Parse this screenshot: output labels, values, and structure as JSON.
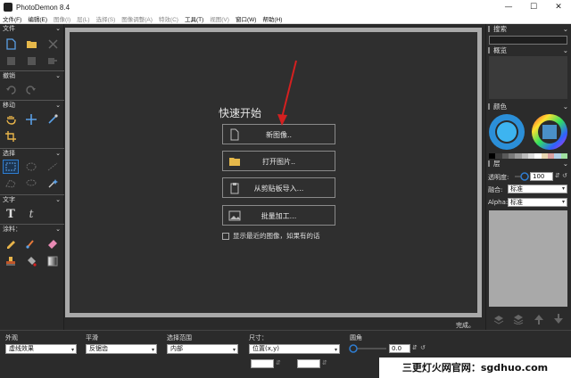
{
  "window": {
    "title": "PhotoDemon 8.4",
    "minimize": "—",
    "maximize": "☐",
    "close": "✕"
  },
  "menu": [
    {
      "label": "文件(F)",
      "enabled": true
    },
    {
      "label": "编辑(E)",
      "enabled": true
    },
    {
      "label": "图像(I)",
      "enabled": false
    },
    {
      "label": "层(L)",
      "enabled": false
    },
    {
      "label": "选择(S)",
      "enabled": false
    },
    {
      "label": "图像调整(A)",
      "enabled": false
    },
    {
      "label": "特效(C)",
      "enabled": false
    },
    {
      "label": "工具(T)",
      "enabled": true
    },
    {
      "label": "视图(V)",
      "enabled": false
    },
    {
      "label": "窗口(W)",
      "enabled": true
    },
    {
      "label": "帮助(H)",
      "enabled": true
    }
  ],
  "toolbox": {
    "sections": {
      "file": "文件",
      "undo": "撤销",
      "move": "移动",
      "select": "选择",
      "text": "文字",
      "paint": "涂料："
    }
  },
  "quick_start": {
    "title": "快速开始",
    "buttons": [
      "新图像..",
      "打开图片..",
      "从剪贴板导入...",
      "批量加工..."
    ],
    "recent_checkbox": "显示最近的图像，如果有的话"
  },
  "status": {
    "text": "完成。"
  },
  "right_panel": {
    "search": "搜索",
    "overview": "概览",
    "color": "颜色",
    "layers": "层",
    "opacity_label": "透明度:",
    "opacity_value": "100",
    "blend_label": "融合:",
    "blend_value": "标准",
    "alpha_label": "Alpha:",
    "alpha_value": "标准",
    "palette": [
      "#000000",
      "#3a3a3a",
      "#5a5a5a",
      "#7a7a7a",
      "#9a9a9a",
      "#bcbcbc",
      "#dcdcdc",
      "#ffffff",
      "#e8d7b0",
      "#d9a0a0",
      "#b0d0e8",
      "#a0e0a0"
    ]
  },
  "bottom_bar": {
    "appearance_label": "外观",
    "appearance_value": "虚线效果",
    "smoothing_label": "平滑",
    "smoothing_value": "反锯齿",
    "area_label": "选择范围",
    "area_value": "内部",
    "size_label": "尺寸：",
    "size_value": "位置(x,y)",
    "corner_label": "圆角",
    "corner_value": "0.0"
  },
  "watermark": "三更灯火网官网：sgdhuo.com",
  "colors": {
    "accent": "#2e7dd1",
    "arrow": "#d42020"
  }
}
